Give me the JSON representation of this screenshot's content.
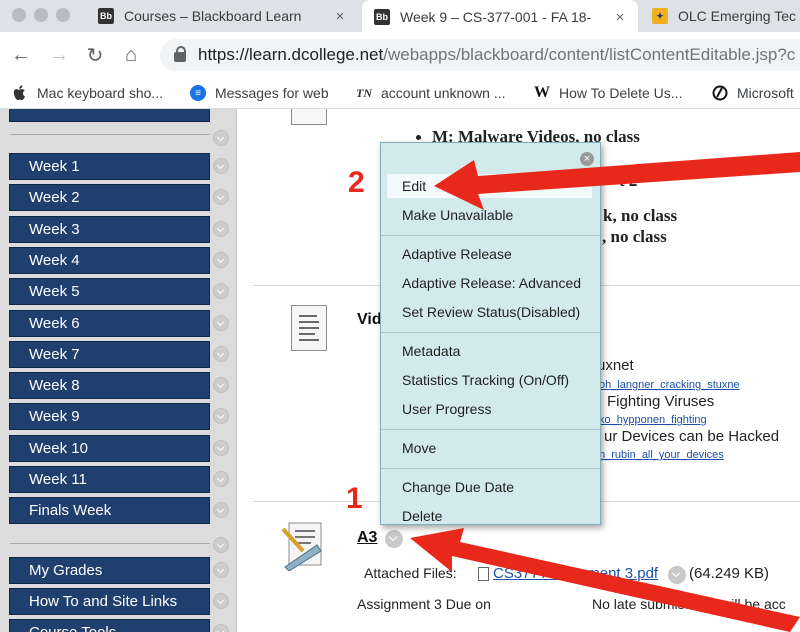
{
  "browser": {
    "tabs": [
      {
        "label": "Courses – Blackboard Learn",
        "favicon": "Bb",
        "active": false
      },
      {
        "label": "Week 9 – CS-377-001 - FA 18-",
        "favicon": "Bb",
        "active": true
      },
      {
        "label": "OLC Emerging Tec",
        "favicon": "olc-icon",
        "active": false
      }
    ],
    "close_glyph": "×",
    "url": {
      "host": "https://learn.dcollege.net",
      "path": "/webapps/blackboard/content/listContentEditable.jsp?c"
    },
    "bookmarks": [
      {
        "label": "Mac keyboard sho...",
        "icon": "apple-icon",
        "glyph": ""
      },
      {
        "label": "Messages for web",
        "icon": "messages-icon",
        "glyph": "≡"
      },
      {
        "label": "account unknown ...",
        "icon": "tn-icon",
        "glyph": "TN"
      },
      {
        "label": "How To Delete Us...",
        "icon": "w-icon",
        "glyph": "W"
      },
      {
        "label": "Microsoft",
        "icon": "microsoft-icon",
        "glyph": ""
      }
    ]
  },
  "sidebar": {
    "weeks": [
      "Week 1",
      "Week 2",
      "Week 3",
      "Week 4",
      "Week 5",
      "Week 6",
      "Week 7",
      "Week 8",
      "Week 9",
      "Week 10",
      "Week 11",
      "Finals Week"
    ],
    "tools": [
      "My Grades",
      "How To and Site Links",
      "Course Tools"
    ]
  },
  "content": {
    "bullets": [
      {
        "text": "M: Malware Videos, no class"
      },
      {
        "text": "t 2"
      },
      {
        "text": "k, no class"
      },
      {
        "text": ", no class"
      }
    ],
    "video_item": {
      "title": "Vid",
      "lines": [
        {
          "text": "uxnet",
          "link": "oh_langner_cracking_stuxne"
        },
        {
          "text": "Fighting Viruses",
          "link": "ko_hypponen_fighting"
        },
        {
          "text": "ur Devices can be Hacked",
          "link": "n_rubin_all_your_devices"
        }
      ]
    },
    "assignment": {
      "title": "A3",
      "attached_label": "Attached Files:",
      "file_name": "CS377 Assignment 3.pdf",
      "file_size": "(64.249 KB)",
      "due_label": "Assignment 3 Due on",
      "note": "No late submissions will be acc"
    }
  },
  "context_menu": {
    "close_glyph": "×",
    "groups": [
      [
        "Edit",
        "Make Unavailable"
      ],
      [
        "Adaptive Release",
        "Adaptive Release: Advanced",
        "Set Review Status(Disabled)"
      ],
      [
        "Metadata",
        "Statistics Tracking (On/Off)",
        "User Progress"
      ],
      [
        "Move"
      ],
      [
        "Change Due Date",
        "Delete"
      ]
    ],
    "highlighted": "Edit"
  },
  "annotations": {
    "step1": "1",
    "step2": "2",
    "arrow_color": "#e8281b"
  },
  "colors": {
    "sidebar_button": "#1f3f6e",
    "menu_bg": "#d3eaed",
    "link": "#1d4fa6"
  }
}
